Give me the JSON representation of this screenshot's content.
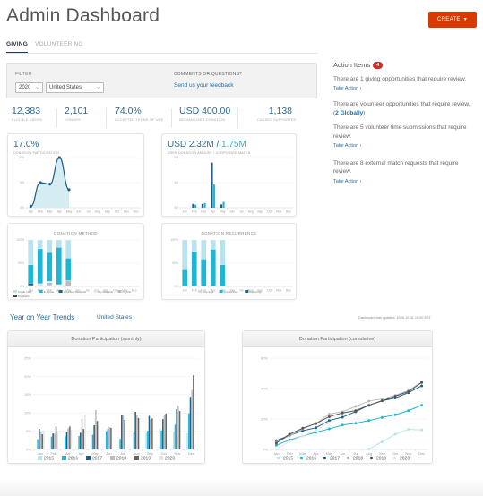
{
  "header": {
    "title": "Admin Dashboard",
    "create_label": "CREATE",
    "create_caret": "▼",
    "accent": "#d83b01"
  },
  "tabs": [
    {
      "label": "GIVING",
      "active": true
    },
    {
      "label": "VOLUNTEERING",
      "active": false
    }
  ],
  "filter": {
    "label": "FILTER",
    "year": "2020",
    "country": "United States",
    "comments_label": "COMMENTS OR QUESTIONS?",
    "feedback_link": "Send us your feedback"
  },
  "stats": [
    {
      "value": "12,383",
      "label": "ELIGIBLE USERS"
    },
    {
      "value": "2,101",
      "label": "DONORS"
    },
    {
      "value": "74.0%",
      "label": "ACCEPTED TERMS OF USE"
    },
    {
      "value": "USD 400.00",
      "label": "MEDIAN USER DONATION"
    },
    {
      "value": "1,138",
      "label": "CAUSES SUPPORTED"
    }
  ],
  "cards": {
    "participation": {
      "value": "17.0%",
      "label": "DONATION PARTICIPATION"
    },
    "amount": {
      "value_main": "USD 2.32M",
      "separator": " / ",
      "value_alt": "1.75M",
      "label": "USER DONATION AMOUNT / CORPORATE MATCH"
    },
    "method": {
      "title": "DONATION METHOD"
    },
    "recurrence": {
      "title": "DONATION RECURRENCE"
    }
  },
  "action_items": {
    "title": "Action Items",
    "count": "4",
    "items": [
      {
        "text": "There are 1 giving opportunities that require review.",
        "link": "Take Action ›"
      },
      {
        "text": "There are volunteer opportunities that require review. (",
        "glob": "2 Globally",
        "tail": ")"
      },
      {
        "text": "There are 5 volunteer time submissions that require review.",
        "link": "Take Action ›"
      },
      {
        "text": "There are 8 external match requests that require review.",
        "link": "Take Action ›"
      }
    ]
  },
  "yoy": {
    "title": "Year on Year Trends",
    "country": "United States",
    "updated": "Dashboard last updated: 1969-12-31 19:00 EST",
    "monthly_title": "Donation Participation (monthly)",
    "cumulative_title": "Donation Participation (cumulative)"
  },
  "chart_data": [
    {
      "id": "participation",
      "type": "area",
      "title": "DONATION PARTICIPATION",
      "categories": [
        "Jan",
        "Feb",
        "Mar",
        "Apr",
        "May",
        "Jun",
        "Jul",
        "Aug",
        "Sep",
        "Oct",
        "Nov",
        "Dec"
      ],
      "values": [
        0.3,
        5.0,
        4.7,
        10.0,
        3.6,
        null,
        null,
        null,
        null,
        null,
        null,
        null
      ],
      "yticks": [
        "0%",
        "5%",
        "10%"
      ],
      "ylim": [
        0,
        10
      ],
      "color": "#1d5f86",
      "fill": "#d5ecf3"
    },
    {
      "id": "amount",
      "type": "bar",
      "title": "USER DONATION AMOUNT / CORPORATE MATCH",
      "categories": [
        "Jan",
        "Feb",
        "Mar",
        "Apr",
        "May",
        "Jun",
        "Jul",
        "Aug",
        "Sep",
        "Oct",
        "Nov",
        "Dec"
      ],
      "yticks": [
        "0M",
        "1M",
        "2M"
      ],
      "ylim": [
        0,
        2
      ],
      "series": [
        {
          "name": "User Donation",
          "color": "#1d5f86",
          "values": [
            0,
            0.15,
            0.15,
            1.8,
            0.13,
            0,
            0,
            0,
            0,
            0,
            0,
            0
          ]
        },
        {
          "name": "Corporate Match",
          "color": "#2bb5d0",
          "values": [
            0,
            0.12,
            0.18,
            0.92,
            0.23,
            0,
            0,
            0,
            0,
            0,
            0,
            0
          ]
        }
      ]
    },
    {
      "id": "method",
      "type": "bar",
      "stacked": true,
      "title": "DONATION METHOD",
      "categories": [
        "Jan",
        "Feb",
        "Mar",
        "Apr",
        "May",
        "Jun",
        "Jul",
        "Aug",
        "Sep",
        "Oct",
        "Nov",
        "Dec"
      ],
      "yticks": [
        "0%",
        "50%",
        "100%"
      ],
      "ylim": [
        0,
        100
      ],
      "series": [
        {
          "name": "My Match",
          "color": "#444444",
          "values": [
            2,
            0,
            0,
            0,
            0,
            0,
            0,
            0,
            0,
            0,
            0,
            0
          ]
        },
        {
          "name": "Volunteer Rewards",
          "color": "#1d5f86",
          "values": [
            5,
            1,
            2,
            1,
            0,
            0,
            0,
            0,
            0,
            0,
            0,
            0
          ]
        },
        {
          "name": "PayPal",
          "color": "#bbbbbb",
          "values": [
            0,
            2,
            6,
            1,
            13,
            0,
            0,
            0,
            0,
            0,
            0,
            0
          ]
        },
        {
          "name": "My Rewards",
          "color": "#e6e6e6",
          "values": [
            0,
            3,
            3,
            2,
            0,
            0,
            0,
            0,
            0,
            0,
            0,
            0
          ]
        },
        {
          "name": "E-Venue",
          "color": "#1fb5d4",
          "values": [
            40,
            75,
            62,
            80,
            48,
            0,
            0,
            0,
            0,
            0,
            0,
            0
          ]
        },
        {
          "name": "Credit Card",
          "color": "#b7e2ee",
          "values": [
            53,
            19,
            27,
            16,
            39,
            0,
            0,
            0,
            0,
            0,
            0,
            0
          ]
        }
      ],
      "legend": [
        "Credit Card",
        "E-Venue",
        "Volunteer Rewards",
        "My Rewards",
        "PayPal",
        "My Match"
      ]
    },
    {
      "id": "recurrence",
      "type": "bar",
      "stacked": true,
      "title": "DONATION RECURRENCE",
      "categories": [
        "Jan",
        "Feb",
        "Mar",
        "Apr",
        "May",
        "Jun",
        "Jul",
        "Aug",
        "Sep",
        "Oct",
        "Nov",
        "Dec"
      ],
      "yticks": [
        "0%",
        "50%",
        "100%"
      ],
      "ylim": [
        0,
        100
      ],
      "series": [
        {
          "name": "Recurring",
          "color": "#1d5f86",
          "values": [
            0,
            1,
            1,
            1,
            0,
            0,
            0,
            0,
            0,
            0,
            0,
            0
          ]
        },
        {
          "name": "Unspecified",
          "color": "#1fb5d4",
          "values": [
            36,
            74,
            58,
            79,
            47,
            0,
            0,
            0,
            0,
            0,
            0,
            0
          ]
        },
        {
          "name": "One-time",
          "color": "#b7e2ee",
          "values": [
            64,
            25,
            41,
            20,
            53,
            0,
            0,
            0,
            0,
            0,
            0,
            0
          ]
        }
      ],
      "legend": [
        "One-time",
        "Unspecified",
        "Recurring"
      ]
    },
    {
      "id": "monthly",
      "type": "bar",
      "title": "Donation Participation (monthly)",
      "categories": [
        "Jan",
        "Feb",
        "Mar",
        "Apr",
        "May",
        "Jun",
        "Jul",
        "Aug",
        "Sep",
        "Oct",
        "Nov",
        "Dec"
      ],
      "yticks": [
        "0%",
        "5%",
        "10%",
        "15%",
        "20%",
        "25%"
      ],
      "ylim": [
        0,
        25
      ],
      "series": [
        {
          "name": "2015",
          "color": "#b7e2ee",
          "values": [
            0,
            0,
            0,
            0,
            0,
            0,
            0,
            0,
            4.7,
            5.8,
            4.8,
            4.4
          ]
        },
        {
          "name": "2016",
          "color": "#1fb5d4",
          "values": [
            2.8,
            3.5,
            3.6,
            3.7,
            4.0,
            5.0,
            2.9,
            4.6,
            5.1,
            5.2,
            6.8,
            9.9
          ]
        },
        {
          "name": "2017",
          "color": "#1d5f86",
          "values": [
            5.6,
            4.4,
            4.8,
            4.6,
            6.6,
            5.6,
            9.3,
            10.3,
            9.2,
            8.3,
            11.0,
            14.4
          ]
        },
        {
          "name": "2018",
          "color": "#bbbbbb",
          "values": [
            4.7,
            4.3,
            5.8,
            8.4,
            10.8,
            6.1,
            9.3,
            9.4,
            8.2,
            9.3,
            11.9,
            16.3
          ]
        },
        {
          "name": "2019",
          "color": "#666666",
          "values": [
            4.2,
            6.3,
            6.3,
            5.6,
            7.8,
            5.9,
            8.1,
            8.6,
            8.5,
            9.8,
            10.5,
            20.3
          ]
        },
        {
          "name": "2020",
          "color": "#e3e3e3",
          "values": [
            5.2,
            4.6,
            5.3,
            9.6,
            6.5,
            0,
            0,
            0,
            0,
            0,
            0,
            0
          ]
        }
      ]
    },
    {
      "id": "cumulative",
      "type": "line",
      "title": "Donation Participation (cumulative)",
      "categories": [
        "Jan",
        "Feb",
        "Mar",
        "Apr",
        "May",
        "Jun",
        "Jul",
        "Aug",
        "Sep",
        "Oct",
        "Nov",
        "Dec"
      ],
      "yticks": [
        "0%",
        "20%",
        "40%",
        "60%"
      ],
      "ylim": [
        0,
        60
      ],
      "series": [
        {
          "name": "2015",
          "color": "#b7e2ee",
          "values": [
            null,
            null,
            null,
            null,
            null,
            null,
            null,
            0.3,
            5,
            10,
            13.2,
            12.8
          ]
        },
        {
          "name": "2016",
          "color": "#1fb5d4",
          "values": [
            2.8,
            6.3,
            8.8,
            11.3,
            13.5,
            16,
            17.2,
            19,
            21,
            22.8,
            25.5,
            29
          ]
        },
        {
          "name": "2017",
          "color": "#1d5f86",
          "values": [
            5.8,
            9.2,
            12.3,
            14.3,
            19,
            21.2,
            24.8,
            29,
            32,
            33.8,
            37.3,
            41.8
          ]
        },
        {
          "name": "2018",
          "color": "#bbbbbb",
          "values": [
            4.7,
            9.0,
            13.5,
            17,
            23.2,
            24.8,
            28.2,
            31.8,
            33.2,
            35.5,
            38.8,
            44.2
          ]
        },
        {
          "name": "2019",
          "color": "#555555",
          "values": [
            4.2,
            10,
            14,
            17,
            21.5,
            24,
            25.5,
            29,
            32,
            35,
            38,
            44
          ]
        },
        {
          "name": "2020",
          "color": "#e3e3e3",
          "values": [
            0,
            5.5,
            8.8,
            12.5,
            17.5,
            null,
            null,
            null,
            null,
            null,
            null,
            null
          ]
        }
      ]
    }
  ]
}
